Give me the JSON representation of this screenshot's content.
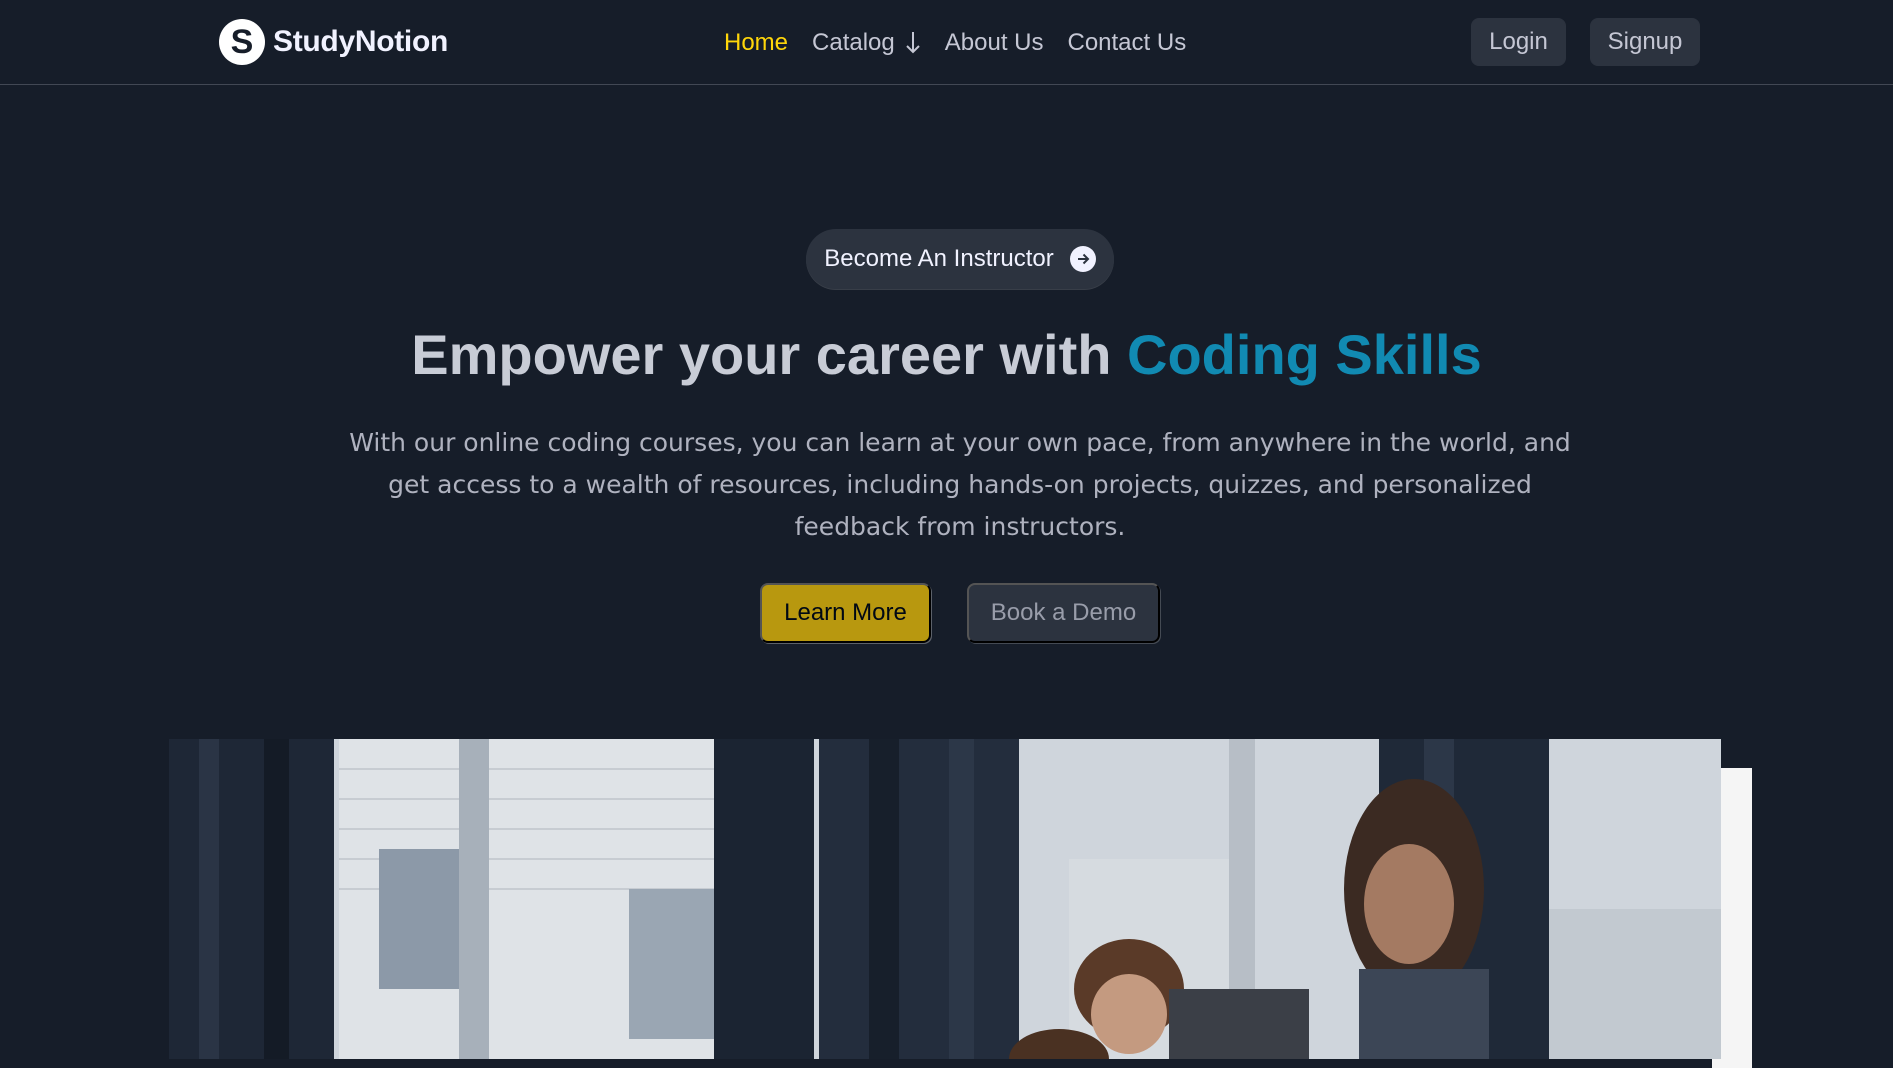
{
  "brand": {
    "logo_letter": "S",
    "name": "StudyNotion"
  },
  "nav": {
    "links": [
      {
        "label": "Home",
        "active": true
      },
      {
        "label": "Catalog",
        "icon": "arrow-down-icon"
      },
      {
        "label": "About Us"
      },
      {
        "label": "Contact Us"
      }
    ],
    "login_label": "Login",
    "signup_label": "Signup"
  },
  "hero": {
    "instructor_label": "Become An Instructor",
    "instructor_icon": "arrow-right-circle-icon",
    "headline_prefix": "Empower your career with ",
    "headline_highlight": "Coding Skills",
    "subtext": "With our online coding courses, you can learn at your own pace, from anywhere in the world, and get access to a wealth of resources, including hands-on projects, quizzes, and personalized feedback from instructors.",
    "learn_more_label": "Learn More",
    "book_demo_label": "Book a Demo",
    "media": "hero-video-classroom"
  },
  "colors": {
    "background": "#161d29",
    "accent_yellow": "#ffd60a",
    "highlight_blue": "#118ab2",
    "button_yellow": "#b8980f"
  }
}
